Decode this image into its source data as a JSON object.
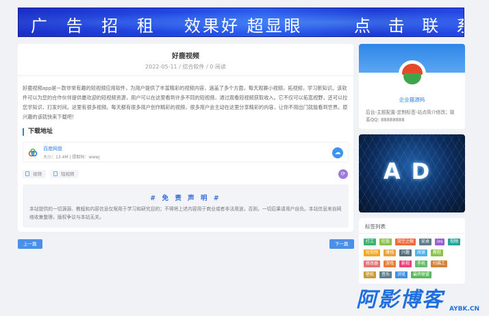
{
  "banner": {
    "part1": "广 告 招 租",
    "part2": "效果好 超显眼",
    "part3": "点 击 联 系"
  },
  "article": {
    "title": "好鹿视频",
    "meta": "2022-05-11  /  综合软件  /  0 阅读",
    "description": "好鹿视频app是一款非常有趣的短视频应用软件，为用户提供了丰富精彩的视频内容，涵盖了多个方面，每天观赛小视频，拓视频，学习新知识。该软件可以为您的合作伙伴提供最欢迎的短视频资源，用户可以在这里看到许多不同的短视频，通过观看短视频获取收入。它不仅可以拓宽视野，还可以拉您学知识，打发时间。这里有很多视频。每天都有很多用户创作精彩的视频，很多用户会主动在这里分享精彩的内容，让你不用出门就能看到世界。原兴趣的该就快来下载吧！",
    "download_section_title": "下载地址",
    "download": {
      "name": "百度网盘",
      "info": "大小：13.4M | 提取码：wwwj"
    },
    "tags": [
      "视频",
      "短视频"
    ],
    "disclaimer_title": "# 免 责 声 明 #",
    "disclaimer_text": "本站提供的一切源源、教程和内容信息仅限用于学习和研究目的；不得将上述内容用于商业或者非法用途，否则，一切后果请用户自负。本站信息来自网络收集整理，版权争议与本站无关。"
  },
  "pager": {
    "prev": "上一篇",
    "next": "下一篇"
  },
  "profile": {
    "name": "企业猫源码",
    "description": "后台-主题配置-定制标签-站点简介修改；联系QQ: 88888888"
  },
  "ad": {
    "text": "AD"
  },
  "tags_panel": {
    "title": "标签列表",
    "tags": [
      {
        "label": "打工",
        "color": "#3cb371"
      },
      {
        "label": "吃饭",
        "color": "#8bc34a"
      },
      {
        "label": "突空之眼",
        "color": "#f06b3c"
      },
      {
        "label": "安卓",
        "color": "#607d8b"
      },
      {
        "label": "ios",
        "color": "#9c5fd6"
      },
      {
        "label": "视频",
        "color": "#26a69a"
      },
      {
        "label": "短视频",
        "color": "#f5a623"
      },
      {
        "label": "赚钱",
        "color": "#e8a33d"
      },
      {
        "label": "兴趣",
        "color": "#546e7a"
      },
      {
        "label": "阅读",
        "color": "#4fb3e8"
      },
      {
        "label": "教程",
        "color": "#8bc34a"
      },
      {
        "label": "修改器",
        "color": "#e57373"
      },
      {
        "label": "游戏",
        "color": "#e97c3a"
      },
      {
        "label": "影视",
        "color": "#ec407a"
      },
      {
        "label": "手机",
        "color": "#66bb6a"
      },
      {
        "label": "扫描工",
        "color": "#d4823a"
      },
      {
        "label": "壁纸",
        "color": "#c79b3b"
      },
      {
        "label": "音乐",
        "color": "#607d8b"
      },
      {
        "label": "浏览",
        "color": "#3d8ee8"
      },
      {
        "label": "最终联盟",
        "color": "#5cb85c"
      }
    ]
  },
  "watermark": {
    "main": "阿影博客",
    "sub": "AYBK.CN"
  }
}
